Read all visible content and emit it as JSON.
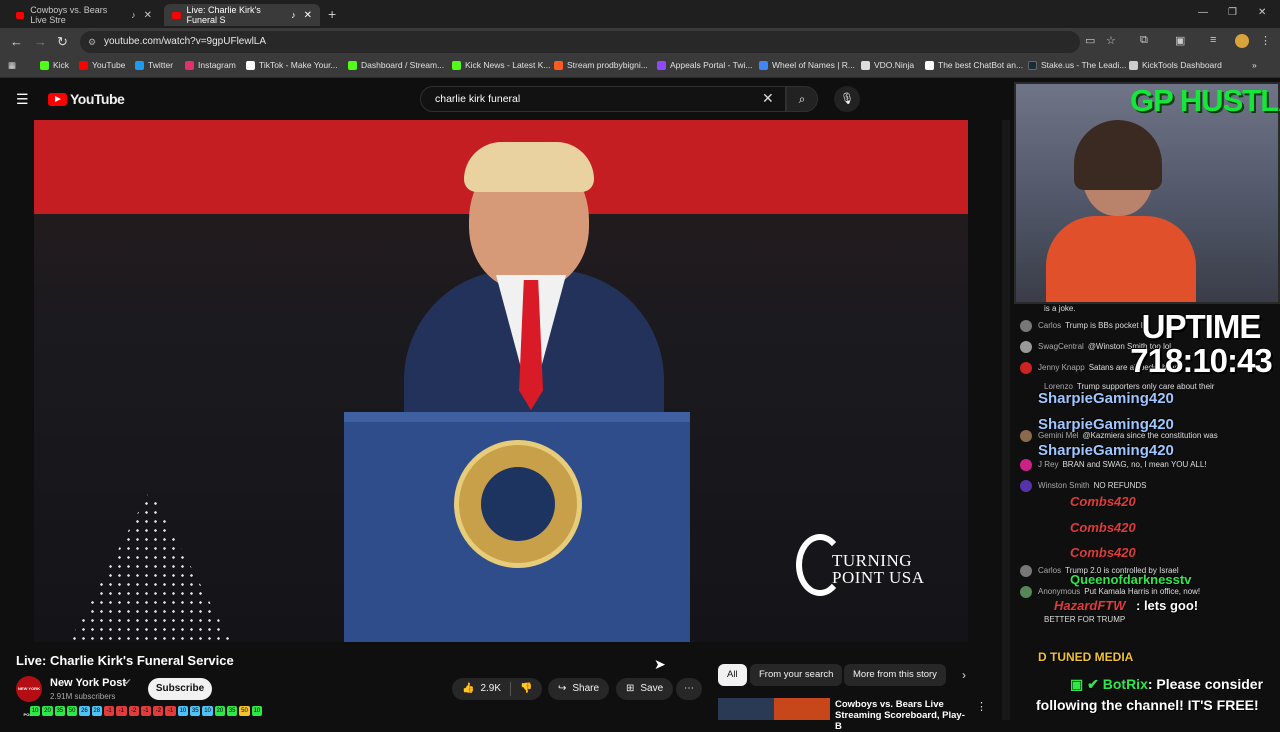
{
  "browser": {
    "tabs": [
      {
        "label": "Cowboys vs. Bears Live Stre",
        "active": false
      },
      {
        "label": "Live: Charlie Kirk's Funeral S",
        "active": true
      }
    ],
    "url": "youtube.com/watch?v=9gpUFlewlLA",
    "bookmarks": [
      {
        "label": "Kick",
        "color": "#53fc18"
      },
      {
        "label": "YouTube",
        "color": "#ff0000"
      },
      {
        "label": "Twitter",
        "color": "#1d9bf0"
      },
      {
        "label": "Instagram",
        "color": "#e1306c"
      },
      {
        "label": "TikTok - Make Your...",
        "color": "#ffffff"
      },
      {
        "label": "Dashboard / Stream...",
        "color": "#53fc18"
      },
      {
        "label": "Kick News - Latest K...",
        "color": "#53fc18"
      },
      {
        "label": "Stream prodbybigni...",
        "color": "#ff5a1f"
      },
      {
        "label": "Appeals Portal - Twi...",
        "color": "#9146ff"
      },
      {
        "label": "Wheel of Names | R...",
        "color": "#4285f4"
      },
      {
        "label": "VDO.Ninja",
        "color": "#dddddd"
      },
      {
        "label": "The best ChatBot an...",
        "color": "#ffffff"
      },
      {
        "label": "Stake.us - The Leadi...",
        "color": "#1a2c38"
      },
      {
        "label": "KickTools Dashboard",
        "color": "#cccccc"
      }
    ]
  },
  "youtube": {
    "logo_text": "YouTube",
    "search_value": "charlie kirk funeral",
    "video_title": "Live: Charlie Kirk's Funeral Service",
    "channel_name": "New York Post",
    "channel_avatar_text": "NEW YORK POST",
    "subscribers": "2.91M subscribers",
    "subscribe_label": "Subscribe",
    "like_count": "2.9K",
    "share_label": "Share",
    "save_label": "Save",
    "overlay_logo_text": "TURNING POINT USA",
    "chips": [
      "All",
      "From your search",
      "More from this story"
    ],
    "recommendation_title": "Cowboys vs. Bears Live Streaming Scoreboard, Play-B"
  },
  "stream_overlay": {
    "brand": "GP HUSTLA",
    "uptime_label": "UPTIME",
    "uptime_value": "718:10:43",
    "chat_messages": [
      {
        "user": "",
        "text": "is a joke.",
        "color": "#555555"
      },
      {
        "user": "Carlos",
        "text": "Trump is BBs pocket lol",
        "color": "#777777"
      },
      {
        "user": "SwagCentral",
        "text": "@Winston Smith too lol",
        "color": "#999999"
      },
      {
        "user": "Jenny Knapp",
        "text": "Satans are all pedophiles",
        "color": "#cc2222"
      },
      {
        "user": "Lorenzo",
        "text": "Trump supporters only care about their",
        "color": "#777777"
      },
      {
        "user": "Gemini Mel",
        "text": "@Kazmiera since the constitution was",
        "color": "#8a6a4a"
      },
      {
        "user": "J Rey",
        "text": "BRAN and SWAG, no, I mean YOU ALL!",
        "color": "#cc2288"
      },
      {
        "user": "Winston Smith",
        "text": "NO REFUNDS",
        "color": "#5533aa"
      },
      {
        "user": "Carlos",
        "text": "Trump 2.0 is controlled by Israel",
        "color": "#777777"
      },
      {
        "user": "Anonymous",
        "text": "Put Kamala Harris in office, now!",
        "color": "#558855"
      },
      {
        "user": "",
        "text": "BETTER FOR TRUMP",
        "color": "#33aa33"
      }
    ],
    "overlay_names": [
      "SharpieGaming420",
      "SharpieGaming420",
      "SharpieGaming420"
    ],
    "overlay_red": [
      "Combs420",
      "Combs420",
      "Combs420"
    ],
    "queen_name": "Queenofdarknesstv",
    "hazard_name": "HazardFTW",
    "hazard_text": ": lets goo!",
    "dtuned": "D TUNED MEDIA",
    "botrix_name": "BotRix",
    "botrix_text": ": Please consider",
    "botrix_line2": "following the channel! IT'S FREE!",
    "bit_badges": [
      "10",
      "20",
      "35",
      "50",
      "26",
      "28",
      "-1",
      "-1",
      "-2",
      "-1",
      "-2",
      "-1",
      "10",
      "35",
      "10",
      "20",
      "35",
      "50",
      "10"
    ]
  }
}
